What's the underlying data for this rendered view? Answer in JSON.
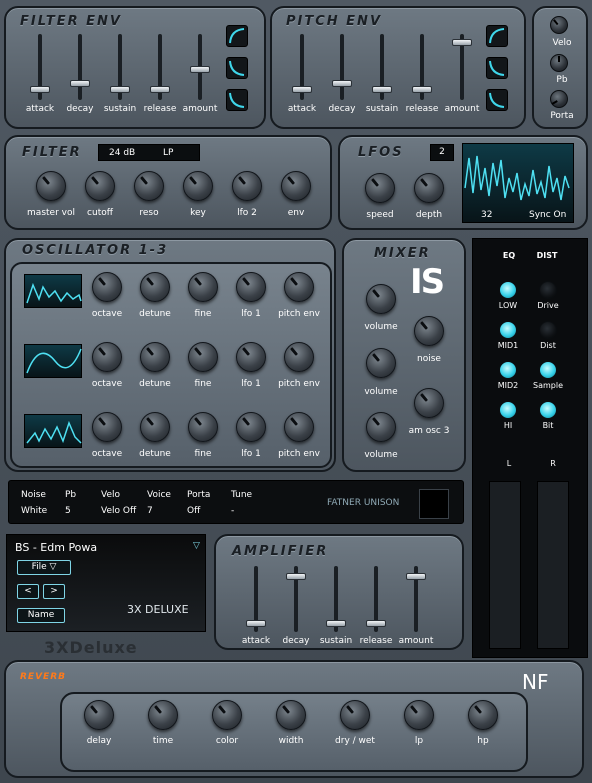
{
  "filter_env": {
    "title": "FILTER ENV",
    "labels": [
      "attack",
      "decay",
      "sustain",
      "release",
      "amount"
    ],
    "levels": [
      0.12,
      0.22,
      0.12,
      0.12,
      0.45
    ]
  },
  "pitch_env": {
    "title": "PITCH ENV",
    "labels": [
      "attack",
      "decay",
      "sustain",
      "release",
      "amount"
    ],
    "levels": [
      0.12,
      0.22,
      0.12,
      0.12,
      0.92
    ]
  },
  "side": {
    "velo": "Velo",
    "pb": "Pb",
    "porta": "Porta"
  },
  "filter": {
    "title": "FILTER",
    "slope": "24 dB",
    "type": "LP",
    "knobs": [
      "master vol",
      "cutoff",
      "reso",
      "key",
      "lfo 2",
      "env"
    ]
  },
  "lfos": {
    "title": "LFOS",
    "number": "2",
    "knobs": [
      "speed",
      "depth"
    ],
    "rate": "32",
    "sync": "Sync On"
  },
  "osc": {
    "title": "OSCILLATOR 1-3",
    "knobs": [
      "octave",
      "detune",
      "fine",
      "lfo 1",
      "pitch env"
    ]
  },
  "mixer": {
    "title": "MIXER",
    "volume": "volume",
    "noise": "noise",
    "am": "am osc 3",
    "logo": "IS"
  },
  "eq": {
    "eq": "EQ",
    "dist": "DIST",
    "low": "LOW",
    "mid1": "MID1",
    "mid2": "MID2",
    "hi": "HI",
    "drive": "Drive",
    "dist_k": "Dist",
    "sample": "Sample",
    "bit": "Bit",
    "l": "L",
    "r": "R"
  },
  "status": {
    "headers": [
      "Noise",
      "Pb",
      "Velo",
      "Voice",
      "Porta",
      "Tune"
    ],
    "values": [
      "White",
      "5",
      "Velo Off",
      "7",
      "Off",
      "-"
    ],
    "unison": "FATNER UNISON"
  },
  "preset": {
    "name": "BS - Edm Powa",
    "file": "File",
    "prev": "<",
    "next": ">",
    "name_btn": "Name",
    "product": "3X DELUXE"
  },
  "logo": {
    "text": "3XDeluxe"
  },
  "amp": {
    "title": "AMPLIFIER",
    "labels": [
      "attack",
      "decay",
      "sustain",
      "release",
      "amount"
    ],
    "levels": [
      0.08,
      0.88,
      0.08,
      0.08,
      0.88
    ]
  },
  "reverb": {
    "title": "REVERB",
    "knobs": [
      "delay",
      "time",
      "color",
      "width",
      "dry / wet",
      "lp",
      "hp"
    ],
    "brand": "NF"
  }
}
